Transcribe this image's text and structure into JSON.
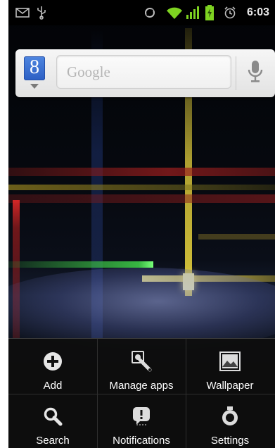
{
  "status_bar": {
    "time": "6:03",
    "left_icons": [
      "gmail-icon",
      "usb-icon"
    ],
    "right_icons": [
      "sync-icon",
      "wifi-icon",
      "signal-icon",
      "battery-charging-icon",
      "alarm-icon"
    ]
  },
  "search_widget": {
    "logo_letter": "8",
    "placeholder": "Google",
    "voice_icon": "microphone-icon"
  },
  "options_menu": {
    "items": [
      {
        "label": "Add",
        "icon": "add-icon"
      },
      {
        "label": "Manage apps",
        "icon": "manage-apps-icon"
      },
      {
        "label": "Wallpaper",
        "icon": "wallpaper-icon"
      },
      {
        "label": "Search",
        "icon": "search-icon"
      },
      {
        "label": "Notifications",
        "icon": "notifications-icon"
      },
      {
        "label": "Settings",
        "icon": "settings-icon"
      }
    ]
  },
  "colors": {
    "menu_background": "#0e0e0e",
    "menu_text": "#ffffff",
    "wifi_green": "#7ed321",
    "google_blue": "#2c5fc4"
  }
}
